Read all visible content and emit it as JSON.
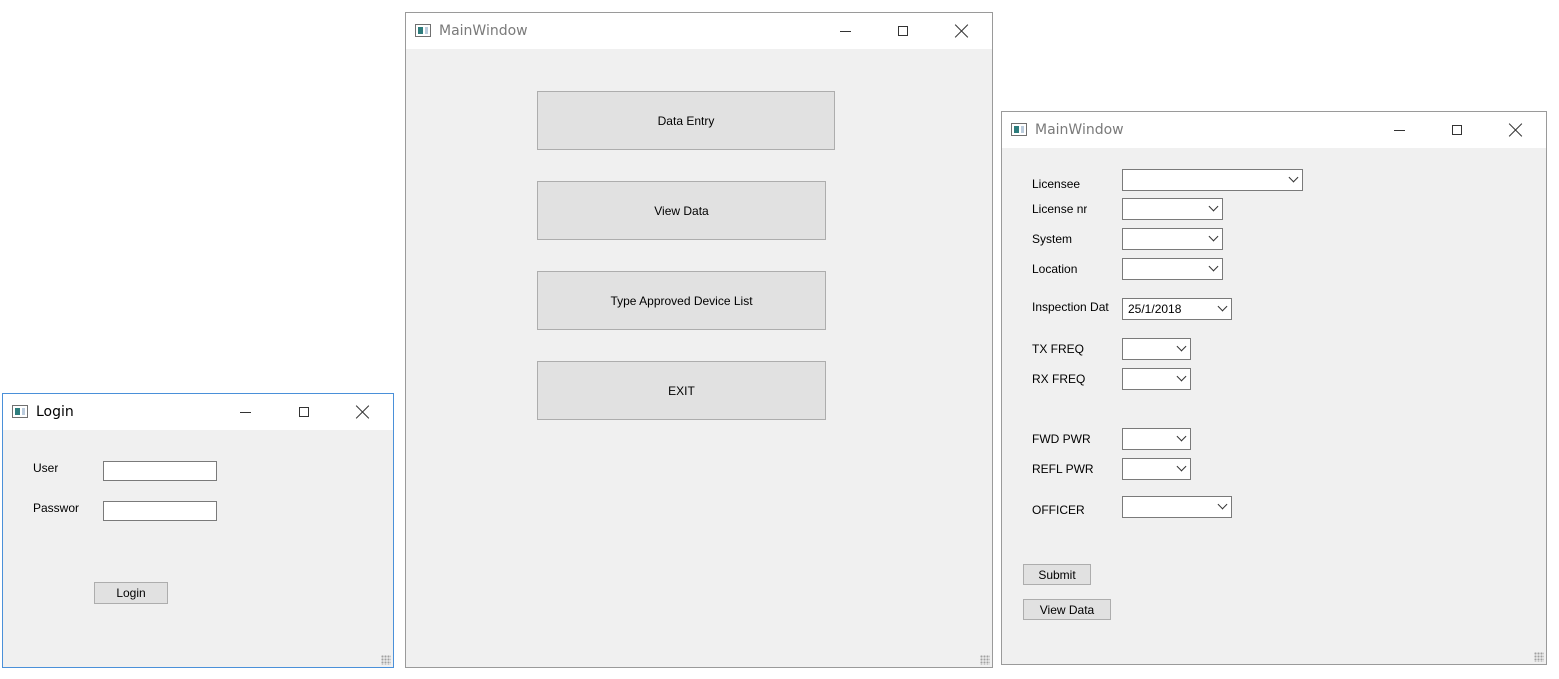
{
  "login_window": {
    "title": "Login",
    "user_label": "User",
    "user_value": "",
    "password_label": "Passwor",
    "password_value": "",
    "login_button": "Login"
  },
  "main_window": {
    "title": "MainWindow",
    "buttons": {
      "data_entry": "Data Entry",
      "view_data": "View Data",
      "type_approved": "Type Approved Device List",
      "exit": "EXIT"
    }
  },
  "entry_window": {
    "title": "MainWindow",
    "fields": {
      "licensee": {
        "label": "Licensee",
        "value": ""
      },
      "license_nr": {
        "label": "License nr",
        "value": ""
      },
      "system": {
        "label": "System",
        "value": ""
      },
      "location": {
        "label": "Location",
        "value": ""
      },
      "inspection_date": {
        "label": "Inspection Dat",
        "value": "25/1/2018"
      },
      "tx_freq": {
        "label": "TX FREQ",
        "value": ""
      },
      "rx_freq": {
        "label": "RX FREQ",
        "value": ""
      },
      "fwd_pwr": {
        "label": "FWD PWR",
        "value": ""
      },
      "refl_pwr": {
        "label": "REFL PWR",
        "value": ""
      },
      "officer": {
        "label": "OFFICER",
        "value": ""
      }
    },
    "submit_button": "Submit",
    "view_data_button": "View Data"
  }
}
